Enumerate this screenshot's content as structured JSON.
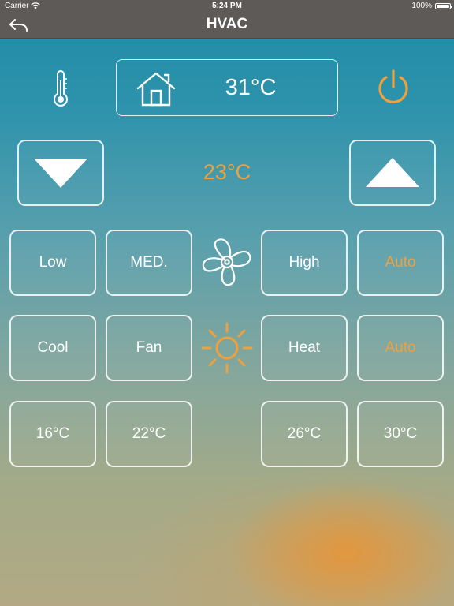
{
  "status_bar": {
    "carrier": "Carrier",
    "time": "5:24 PM",
    "battery": "100%"
  },
  "nav": {
    "title": "HVAC",
    "back_icon": "back-arrow-icon"
  },
  "indoor": {
    "temperature": "31°C",
    "thermometer_icon": "thermometer-icon",
    "home_icon": "house-icon"
  },
  "power_icon": "power-icon",
  "setpoint": {
    "value": "23°C",
    "down_icon": "triangle-down-icon",
    "up_icon": "triangle-up-icon"
  },
  "fan_speed": {
    "icon": "fan-icon",
    "buttons": [
      "Low",
      "MED.",
      "High",
      "Auto"
    ]
  },
  "mode": {
    "icon": "sun-icon",
    "buttons": [
      "Cool",
      "Fan",
      "Heat",
      "Auto"
    ]
  },
  "presets": {
    "buttons": [
      "16°C",
      "22°C",
      "26°C",
      "30°C"
    ]
  },
  "colors": {
    "accent_orange": "#f0a03c",
    "bar_gray": "#5d5a58",
    "white": "#ffffff"
  }
}
